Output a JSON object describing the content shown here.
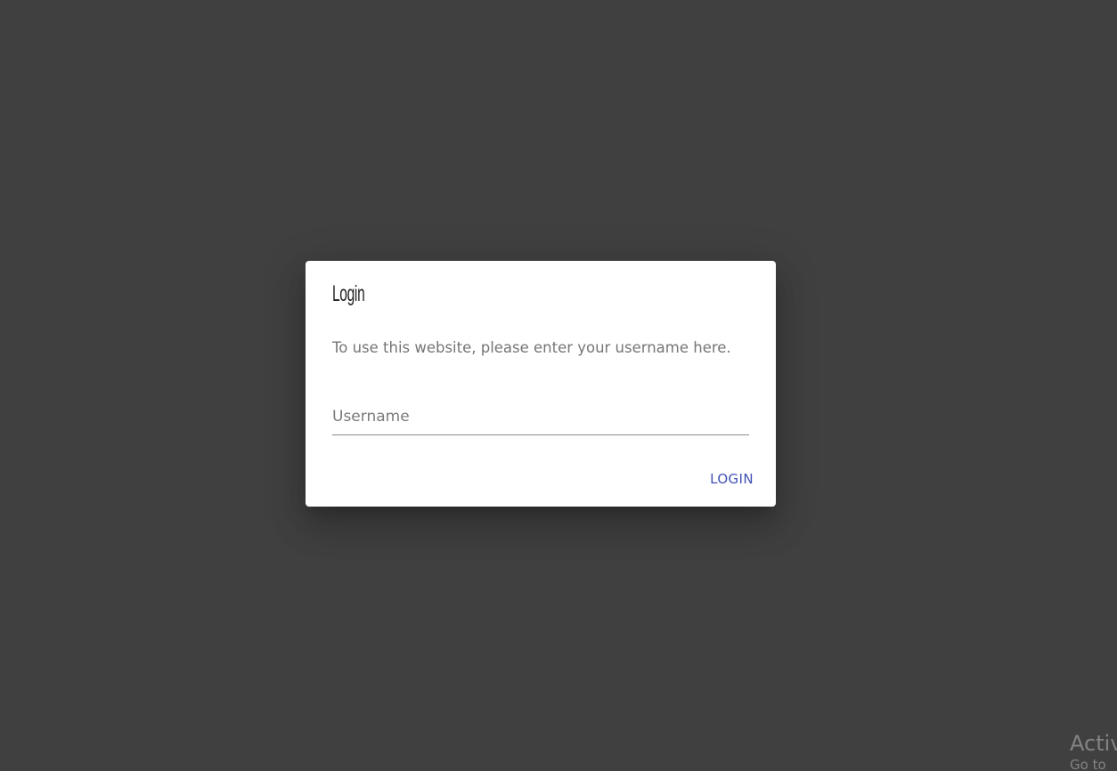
{
  "dialog": {
    "title": "Login",
    "description": "To use this website, please enter your username here.",
    "username_field": {
      "placeholder": "Username",
      "value": ""
    },
    "login_label": "LOGIN"
  },
  "watermark": {
    "line1": "Activ",
    "line2": "Go to"
  },
  "colors": {
    "backdrop": "#404040",
    "accent": "#3f51b5",
    "dialog_background": "#ffffff"
  }
}
